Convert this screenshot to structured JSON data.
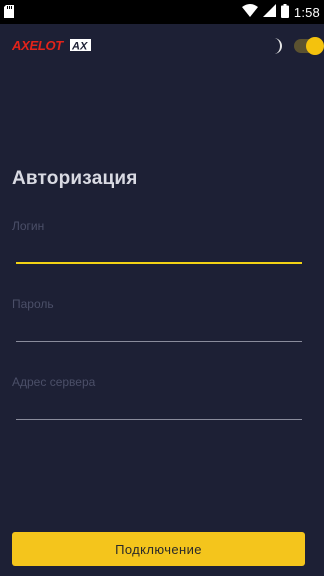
{
  "status_bar": {
    "time": "1:58",
    "icons": [
      "sd-card-icon",
      "wifi-icon",
      "signal-icon",
      "battery-icon"
    ]
  },
  "header": {
    "logo_text": "AXELOT AX",
    "theme_icon": "moon-icon",
    "theme_toggle_on": true
  },
  "form": {
    "title": "Авторизация",
    "login": {
      "label": "Логин",
      "value": ""
    },
    "password": {
      "label": "Пароль",
      "value": ""
    },
    "server": {
      "label": "Адрес сервера",
      "value": ""
    }
  },
  "connect_button": {
    "label": "Подключение"
  },
  "colors": {
    "background": "#1d2035",
    "accent": "#f4c51c",
    "brand_red": "#e2231a"
  }
}
